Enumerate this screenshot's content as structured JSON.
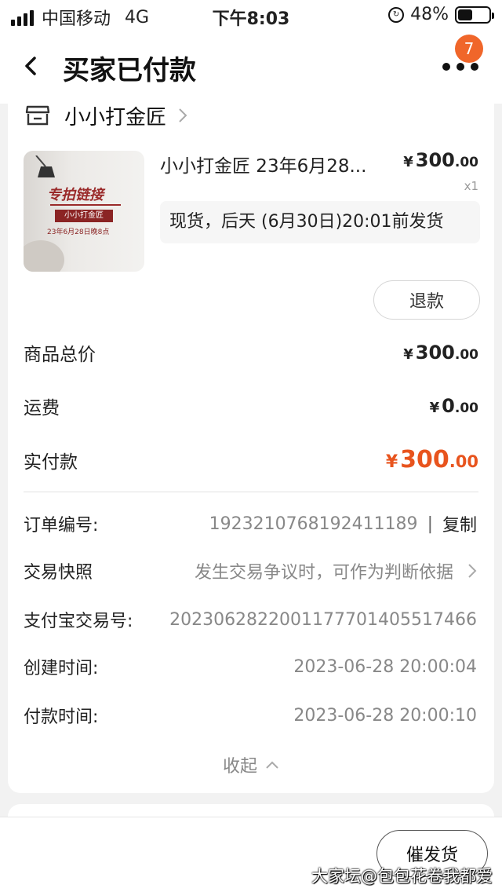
{
  "status_bar": {
    "carrier": "中国移动",
    "network": "4G",
    "time": "下午8:03",
    "battery": "48%",
    "battery_level": 0.48
  },
  "nav": {
    "title": "买家已付款",
    "badge_count": "7"
  },
  "shop": {
    "name": "小小打金匠"
  },
  "product": {
    "thumb_title": "专拍链接",
    "thumb_shop": "小小打金匠",
    "thumb_date": "23年6月28日晚8点",
    "title": "小小打金匠 23年6月28...",
    "price_int": "300",
    "price_dec": ".00",
    "currency": "¥",
    "qty": "x1",
    "ship_note": "现货，后天 (6月30日)20:01前发货",
    "refund_label": "退款"
  },
  "summary": {
    "goods_total_label": "商品总价",
    "goods_total_int": "300",
    "goods_total_dec": ".00",
    "shipping_label": "运费",
    "shipping_int": "0",
    "shipping_dec": ".00",
    "paid_label": "实付款",
    "paid_int": "300",
    "paid_dec": ".00"
  },
  "order_info": {
    "order_no_label": "订单编号:",
    "order_no": "1923210768192411189",
    "separator": "|",
    "copy_label": "复制",
    "snapshot_label": "交易快照",
    "snapshot_value": "发生交易争议时，可作为判断依据",
    "alipay_label": "支付宝交易号:",
    "alipay_no": "2023062822001177701405517466",
    "created_label": "创建时间:",
    "created_time": "2023-06-28 20:00:04",
    "paid_time_label": "付款时间:",
    "paid_time": "2023-06-28 20:00:10",
    "collapse_label": "收起"
  },
  "bottom": {
    "urge_label": "催发货",
    "watermark": "大家坛@包包花卷我都爱"
  },
  "colors": {
    "accent": "#e8541e",
    "badge": "#f0662a",
    "thumb_red": "#9a2a2a"
  }
}
